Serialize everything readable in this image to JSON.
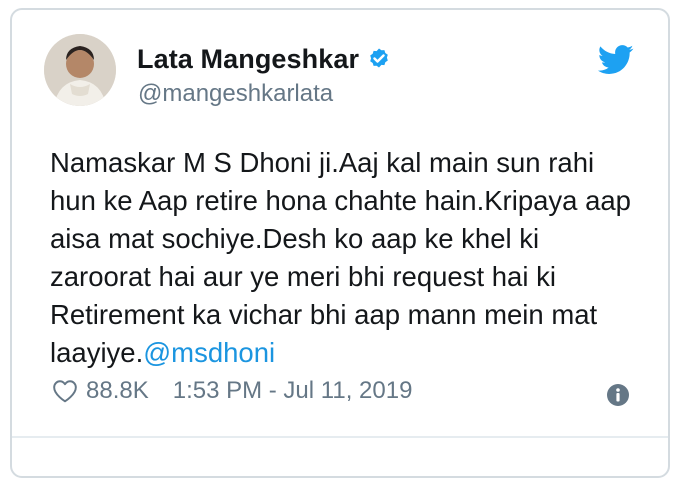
{
  "author": {
    "name": "Lata Mangeshkar",
    "handle": "@mangeshkarlata",
    "verified": true
  },
  "tweet": {
    "lines": [
      "Namaskar M S Dhoni ji.Aaj kal main sun rahi",
      "hun ke Aap retire hona chahte hain.Kripaya aap",
      "aisa mat sochiye.Desh ko aap ke khel ki",
      "zaroorat hai aur ye meri bhi request hai ki",
      "Retirement ka vichar bhi aap mann mein mat",
      "laayiye."
    ],
    "mention": "@msdhoni"
  },
  "footer": {
    "likes": "88.8K",
    "timestamp": "1:53 PM - Jul 11, 2019"
  },
  "colors": {
    "text": "#14171a",
    "secondary": "#657786",
    "link": "#1b95e0",
    "twitter_blue": "#1da1f2",
    "info_icon": "#657786"
  },
  "icons": {
    "logo": "twitter-bird-icon",
    "verified": "verified-badge-icon",
    "like": "heart-outline-icon",
    "info": "info-circle-icon"
  }
}
